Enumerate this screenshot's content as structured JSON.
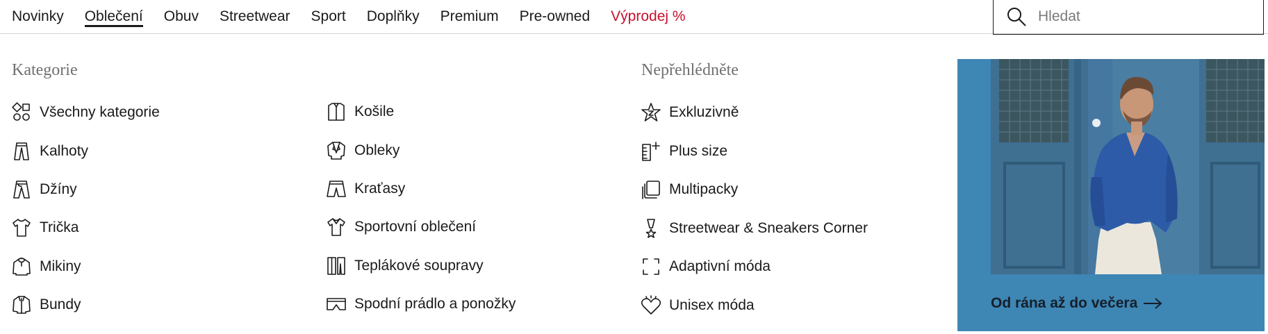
{
  "nav": {
    "items": [
      {
        "label": "Novinky"
      },
      {
        "label": "Oblečení",
        "active": true
      },
      {
        "label": "Obuv"
      },
      {
        "label": "Streetwear"
      },
      {
        "label": "Sport"
      },
      {
        "label": "Doplňky"
      },
      {
        "label": "Premium"
      },
      {
        "label": "Pre-owned"
      },
      {
        "label": "Výprodej %",
        "accent": "#c8102e"
      }
    ],
    "search_placeholder": "Hledat"
  },
  "categories": {
    "heading": "Kategorie",
    "col1": [
      {
        "label": "Všechny kategorie",
        "icon": "grid-icon"
      },
      {
        "label": "Kalhoty",
        "icon": "trousers-icon"
      },
      {
        "label": "Džíny",
        "icon": "jeans-icon"
      },
      {
        "label": "Trička",
        "icon": "tshirt-icon"
      },
      {
        "label": "Mikiny",
        "icon": "hoodie-icon"
      },
      {
        "label": "Bundy",
        "icon": "jacket-icon"
      }
    ],
    "col2": [
      {
        "label": "Košile",
        "icon": "shirt-icon"
      },
      {
        "label": "Obleky",
        "icon": "suit-icon"
      },
      {
        "label": "Kraťasy",
        "icon": "shorts-icon"
      },
      {
        "label": "Sportovní oblečení",
        "icon": "sport-shirt-icon"
      },
      {
        "label": "Teplákové soupravy",
        "icon": "tracksuit-icon"
      },
      {
        "label": "Spodní prádlo a ponožky",
        "icon": "underwear-icon"
      }
    ]
  },
  "highlights": {
    "heading": "Nepřehlédněte",
    "items": [
      {
        "label": "Exkluzivně",
        "icon": "star-z-icon"
      },
      {
        "label": "Plus size",
        "icon": "ruler-plus-icon"
      },
      {
        "label": "Multipacky",
        "icon": "multipack-icon"
      },
      {
        "label": "Streetwear & Sneakers Corner",
        "icon": "trophy-star-icon"
      },
      {
        "label": "Adaptivní móda",
        "icon": "expand-corners-icon"
      },
      {
        "label": "Unisex móda",
        "icon": "heart-icon"
      }
    ]
  },
  "promo": {
    "caption": "Od rána až do večera",
    "bg_color": "#3e86b4"
  }
}
